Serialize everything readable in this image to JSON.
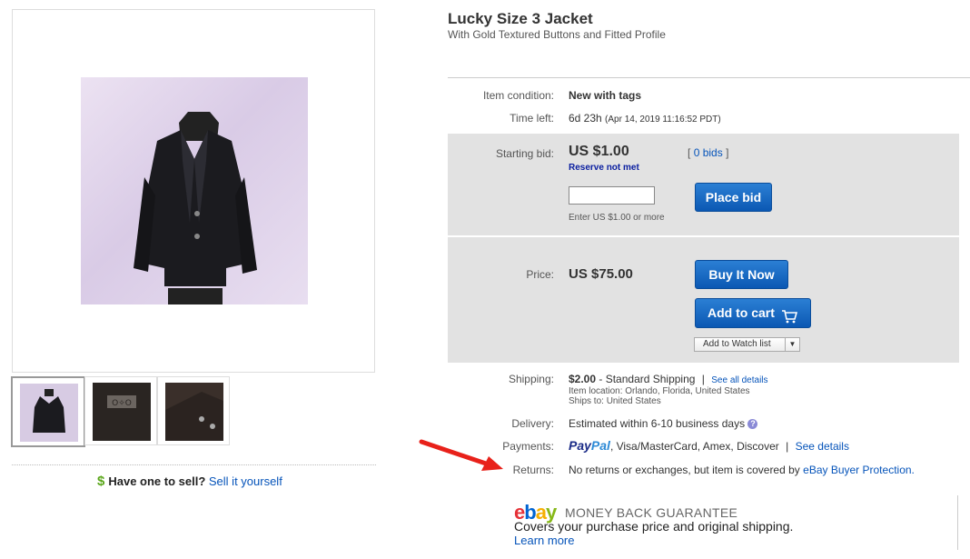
{
  "item": {
    "title": "Lucky Size 3 Jacket",
    "subtitle": "With Gold Textured Buttons and Fitted Profile"
  },
  "details": {
    "condition_label": "Item condition:",
    "condition_value": "New with tags",
    "time_left_label": "Time left:",
    "time_left_value": "6d 23h",
    "time_left_date": "(Apr 14, 2019 11:16:52 PDT)"
  },
  "bid": {
    "label": "Starting bid:",
    "price": "US $1.00",
    "bids_open": "[",
    "bids_link": "0 bids",
    "bids_close": "]",
    "reserve": "Reserve not met",
    "input_value": "",
    "hint": "Enter US $1.00 or more",
    "button": "Place bid"
  },
  "buy": {
    "label": "Price:",
    "price": "US $75.00",
    "buy_now": "Buy It Now",
    "add_to_cart": "Add to cart",
    "watch": "Add to Watch list"
  },
  "shipping": {
    "label": "Shipping:",
    "price": "$2.00",
    "method": "- Standard Shipping",
    "sep": "|",
    "see_all": "See all details",
    "location": "Item location: Orlando, Florida, United States",
    "ships_to": "Ships to: United States"
  },
  "delivery": {
    "label": "Delivery:",
    "value": "Estimated within 6-10 business days",
    "help": "?"
  },
  "payments": {
    "label": "Payments:",
    "paypal_1": "Pay",
    "paypal_2": "Pal",
    "methods": ", Visa/MasterCard, Amex, Discover",
    "sep": "|",
    "see_details": "See details"
  },
  "returns": {
    "label": "Returns:",
    "text": "No returns or exchanges, but item is covered by",
    "link": "eBay Buyer Protection."
  },
  "guarantee": {
    "logo_e": "e",
    "logo_b": "b",
    "logo_a": "a",
    "logo_y": "y",
    "title": "MONEY BACK GUARANTEE",
    "covers": "Covers your purchase price and original shipping.",
    "learn_more": "Learn more"
  },
  "sell": {
    "dollar": "$",
    "question": "Have one to sell?",
    "link": "Sell it yourself"
  },
  "colors": {
    "link": "#0654ba",
    "button": "#0b58b3",
    "panel": "#e2e2e2",
    "arrow": "#e8211a"
  }
}
